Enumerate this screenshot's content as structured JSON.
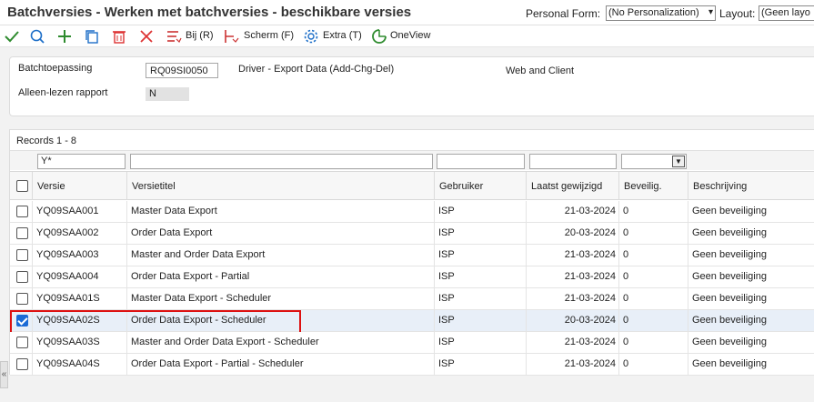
{
  "header": {
    "title": "Batchversies - Werken met batchversies - beschikbare versies",
    "personal_form_label": "Personal Form:",
    "personal_form_value": "(No Personalization)",
    "layout_label": "Layout:",
    "layout_value": "(Geen layo"
  },
  "toolbar": {
    "bij_label": "Bij (R)",
    "scherm_label": "Scherm (F)",
    "extra_label": "Extra (T)",
    "oneview_label": "OneView",
    "icons": [
      "check-icon",
      "search-icon",
      "plus-icon",
      "copy-icon",
      "trash-icon",
      "close-icon",
      "row-menu-icon",
      "form-menu-icon",
      "gear-icon",
      "oneview-icon"
    ]
  },
  "form": {
    "batch_app_label": "Batchtoepassing",
    "batch_app_value": "RQ09SI0050",
    "batch_app_desc": "Driver - Export Data (Add-Chg-Del)",
    "platform": "Web and Client",
    "readonly_label": "Alleen-lezen rapport",
    "readonly_value": "N"
  },
  "grid": {
    "records_label": "Records 1 - 8",
    "filter_version": "Y*",
    "columns": {
      "versie": "Versie",
      "titel": "Versietitel",
      "gebruiker": "Gebruiker",
      "laatst": "Laatst gewijzigd",
      "beveilig": "Beveilig.",
      "beschrijving": "Beschrijving"
    },
    "rows": [
      {
        "versie": "YQ09SAA001",
        "titel": "Master Data Export",
        "gebruiker": "ISP",
        "datum": "21-03-2024",
        "beveilig": "0",
        "beschrijving": "Geen beveiliging",
        "checked": false
      },
      {
        "versie": "YQ09SAA002",
        "titel": "Order Data Export",
        "gebruiker": "ISP",
        "datum": "20-03-2024",
        "beveilig": "0",
        "beschrijving": "Geen beveiliging",
        "checked": false
      },
      {
        "versie": "YQ09SAA003",
        "titel": "Master and Order Data Export",
        "gebruiker": "ISP",
        "datum": "21-03-2024",
        "beveilig": "0",
        "beschrijving": "Geen beveiliging",
        "checked": false
      },
      {
        "versie": "YQ09SAA004",
        "titel": "Order Data Export - Partial",
        "gebruiker": "ISP",
        "datum": "21-03-2024",
        "beveilig": "0",
        "beschrijving": "Geen beveiliging",
        "checked": false
      },
      {
        "versie": "YQ09SAA01S",
        "titel": "Master Data Export - Scheduler",
        "gebruiker": "ISP",
        "datum": "21-03-2024",
        "beveilig": "0",
        "beschrijving": "Geen beveiliging",
        "checked": false
      },
      {
        "versie": "YQ09SAA02S",
        "titel": "Order Data Export - Scheduler",
        "gebruiker": "ISP",
        "datum": "20-03-2024",
        "beveilig": "0",
        "beschrijving": "Geen beveiliging",
        "checked": true
      },
      {
        "versie": "YQ09SAA03S",
        "titel": "Master and Order Data Export - Scheduler",
        "gebruiker": "ISP",
        "datum": "21-03-2024",
        "beveilig": "0",
        "beschrijving": "Geen beveiliging",
        "checked": false
      },
      {
        "versie": "YQ09SAA04S",
        "titel": "Order Data Export - Partial - Scheduler",
        "gebruiker": "ISP",
        "datum": "21-03-2024",
        "beveilig": "0",
        "beschrijving": "Geen beveiliging",
        "checked": false
      }
    ]
  },
  "colors": {
    "selected_row": "#e8eff8",
    "highlight": "#dd1111",
    "checkbox": "#1b6bd6"
  }
}
